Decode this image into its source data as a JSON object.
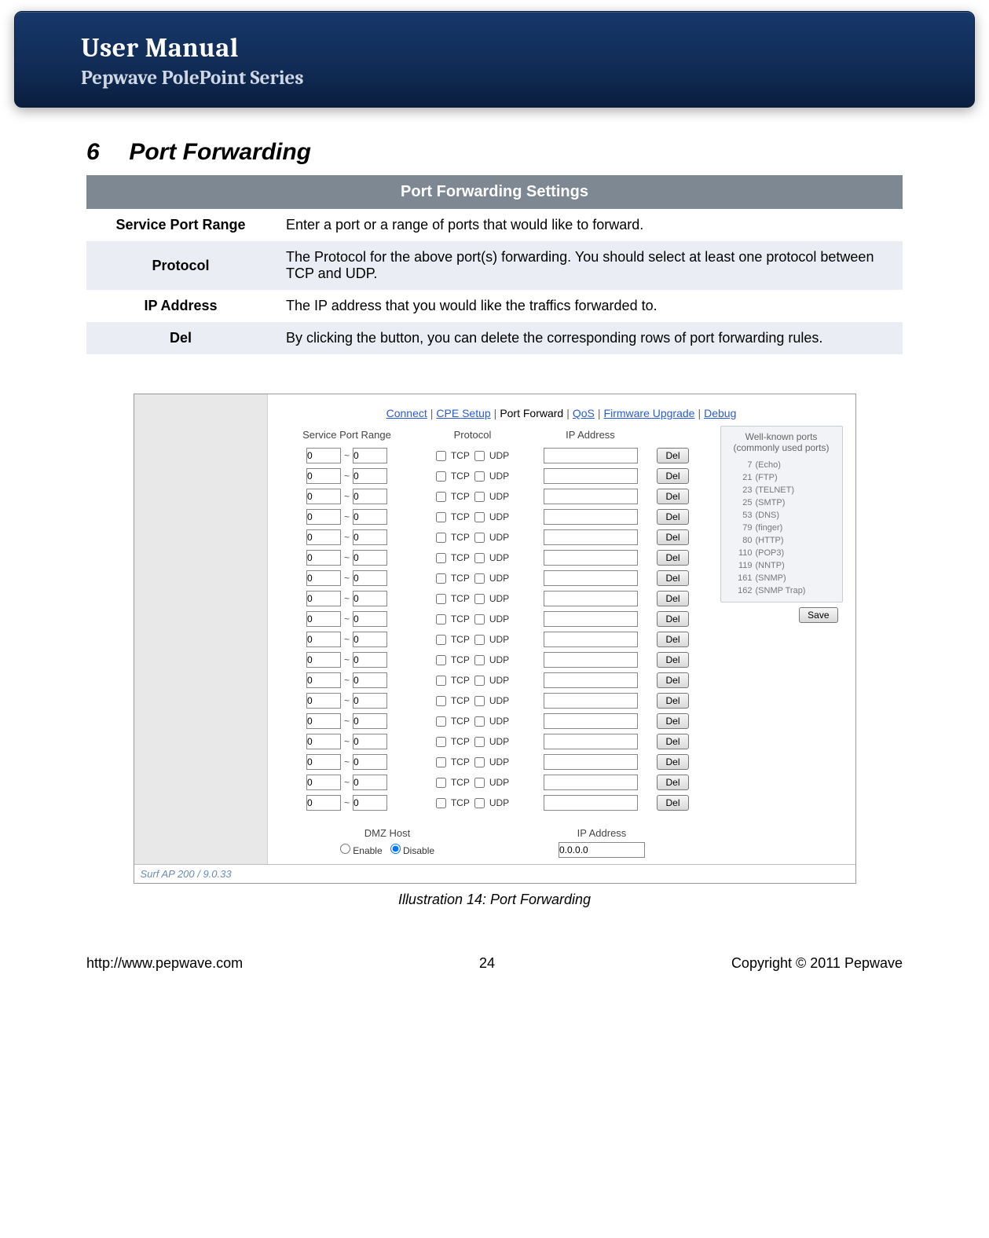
{
  "header": {
    "title": "User Manual",
    "subtitle": "Pepwave PolePoint Series"
  },
  "section": {
    "number": "6",
    "title": "Port Forwarding"
  },
  "settings_table": {
    "header": "Port Forwarding Settings",
    "rows": [
      {
        "label": "Service Port Range",
        "desc": "Enter a port or a range of ports that would like to forward."
      },
      {
        "label": "Protocol",
        "desc": "The Protocol for the above port(s) forwarding. You should select at least one protocol between TCP and UDP."
      },
      {
        "label": "IP Address",
        "desc": "The IP address that you would like the traffics forwarded to."
      },
      {
        "label": "Del",
        "desc": "By clicking the button, you can delete the corresponding rows of port forwarding rules."
      }
    ]
  },
  "figure": {
    "nav": {
      "items": [
        "Connect",
        "CPE Setup",
        "Port Forward",
        "QoS",
        "Firmware Upgrade",
        "Debug"
      ],
      "active_index": 2
    },
    "columns": {
      "range": "Service Port Range",
      "proto": "Protocol",
      "ip": "IP Address"
    },
    "proto_labels": {
      "tcp": "TCP",
      "udp": "UDP"
    },
    "row_default": {
      "from": "0",
      "to": "0",
      "ip": ""
    },
    "row_count": 18,
    "del_label": "Del",
    "well": {
      "title": "Well-known ports (commonly used ports)",
      "items": [
        {
          "port": "7",
          "name": "(Echo)"
        },
        {
          "port": "21",
          "name": "(FTP)"
        },
        {
          "port": "23",
          "name": "(TELNET)"
        },
        {
          "port": "25",
          "name": "(SMTP)"
        },
        {
          "port": "53",
          "name": "(DNS)"
        },
        {
          "port": "79",
          "name": "(finger)"
        },
        {
          "port": "80",
          "name": "(HTTP)"
        },
        {
          "port": "110",
          "name": "(POP3)"
        },
        {
          "port": "119",
          "name": "(NNTP)"
        },
        {
          "port": "161",
          "name": "(SNMP)"
        },
        {
          "port": "162",
          "name": "(SNMP Trap)"
        }
      ]
    },
    "dmz": {
      "host_label": "DMZ Host",
      "ip_label": "IP Address",
      "enable": "Enable",
      "disable": "Disable",
      "ip_value": "0.0.0.0",
      "selected": "disable"
    },
    "save_label": "Save",
    "status": "Surf AP 200 / 9.0.33",
    "caption": "Illustration 14: Port Forwarding"
  },
  "footer": {
    "left": "http://www.pepwave.com",
    "center": "24",
    "right": "Copyright © 2011 Pepwave"
  }
}
